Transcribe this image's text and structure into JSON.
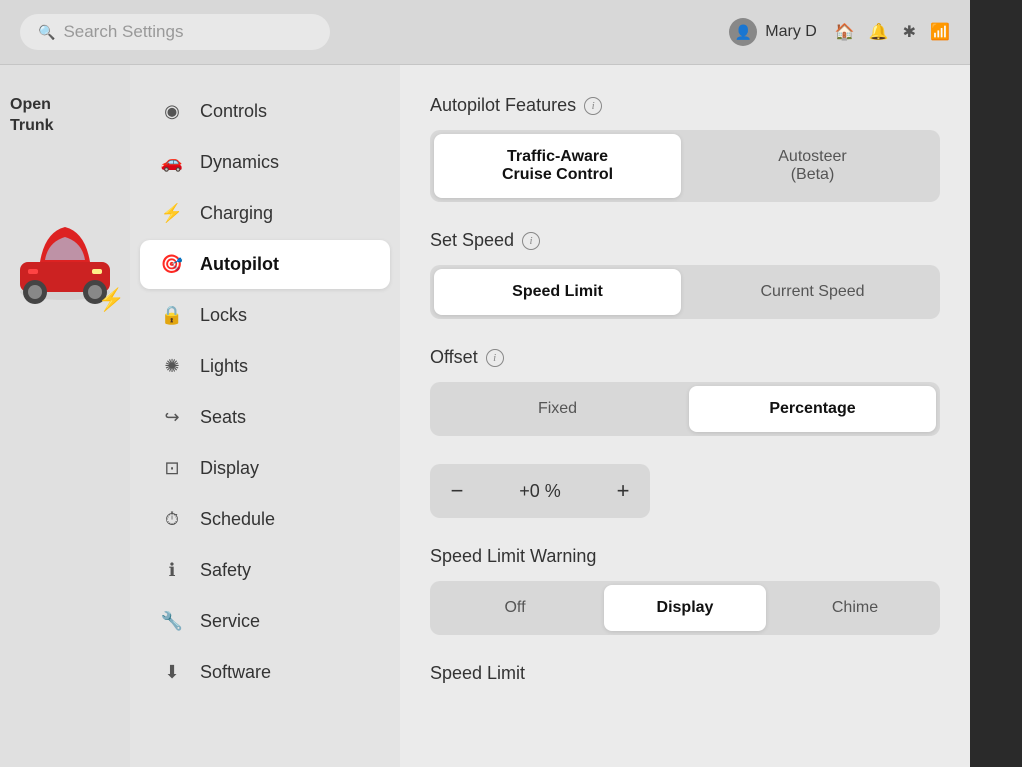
{
  "header": {
    "search_placeholder": "Search Settings",
    "user_name": "Mary D",
    "icons": [
      "home",
      "bell",
      "bluetooth",
      "signal"
    ]
  },
  "car_panel": {
    "open_trunk_label": "Open\nTrunk"
  },
  "nav": {
    "items": [
      {
        "id": "controls",
        "label": "Controls",
        "icon": "👁"
      },
      {
        "id": "dynamics",
        "label": "Dynamics",
        "icon": "🚗"
      },
      {
        "id": "charging",
        "label": "Charging",
        "icon": "⚡"
      },
      {
        "id": "autopilot",
        "label": "Autopilot",
        "icon": "🎯",
        "active": true
      },
      {
        "id": "locks",
        "label": "Locks",
        "icon": "🔒"
      },
      {
        "id": "lights",
        "label": "Lights",
        "icon": "💡"
      },
      {
        "id": "seats",
        "label": "Seats",
        "icon": "↪"
      },
      {
        "id": "display",
        "label": "Display",
        "icon": "⊡"
      },
      {
        "id": "schedule",
        "label": "Schedule",
        "icon": "🕐"
      },
      {
        "id": "safety",
        "label": "Safety",
        "icon": "ℹ"
      },
      {
        "id": "service",
        "label": "Service",
        "icon": "🔧"
      },
      {
        "id": "software",
        "label": "Software",
        "icon": "⬇"
      }
    ]
  },
  "main": {
    "sections": [
      {
        "id": "autopilot-features",
        "title": "Autopilot Features",
        "type": "button-group",
        "options": [
          {
            "label": "Traffic-Aware\nCruise Control",
            "selected": true
          },
          {
            "label": "Autosteer\n(Beta)",
            "selected": false
          }
        ]
      },
      {
        "id": "set-speed",
        "title": "Set Speed",
        "type": "button-group",
        "options": [
          {
            "label": "Speed Limit",
            "selected": true
          },
          {
            "label": "Current Speed",
            "selected": false
          }
        ]
      },
      {
        "id": "offset",
        "title": "Offset",
        "type": "button-group",
        "options": [
          {
            "label": "Fixed",
            "selected": false
          },
          {
            "label": "Percentage",
            "selected": true
          }
        ]
      },
      {
        "id": "offset-stepper",
        "title": "",
        "type": "stepper",
        "value": "+0 %",
        "minus_label": "−",
        "plus_label": "+"
      },
      {
        "id": "speed-limit-warning",
        "title": "Speed Limit Warning",
        "type": "button-group",
        "options": [
          {
            "label": "Off",
            "selected": false
          },
          {
            "label": "Display",
            "selected": true
          },
          {
            "label": "Chime",
            "selected": false
          }
        ]
      },
      {
        "id": "speed-limit",
        "title": "Speed Limit",
        "type": "header-only"
      }
    ]
  }
}
